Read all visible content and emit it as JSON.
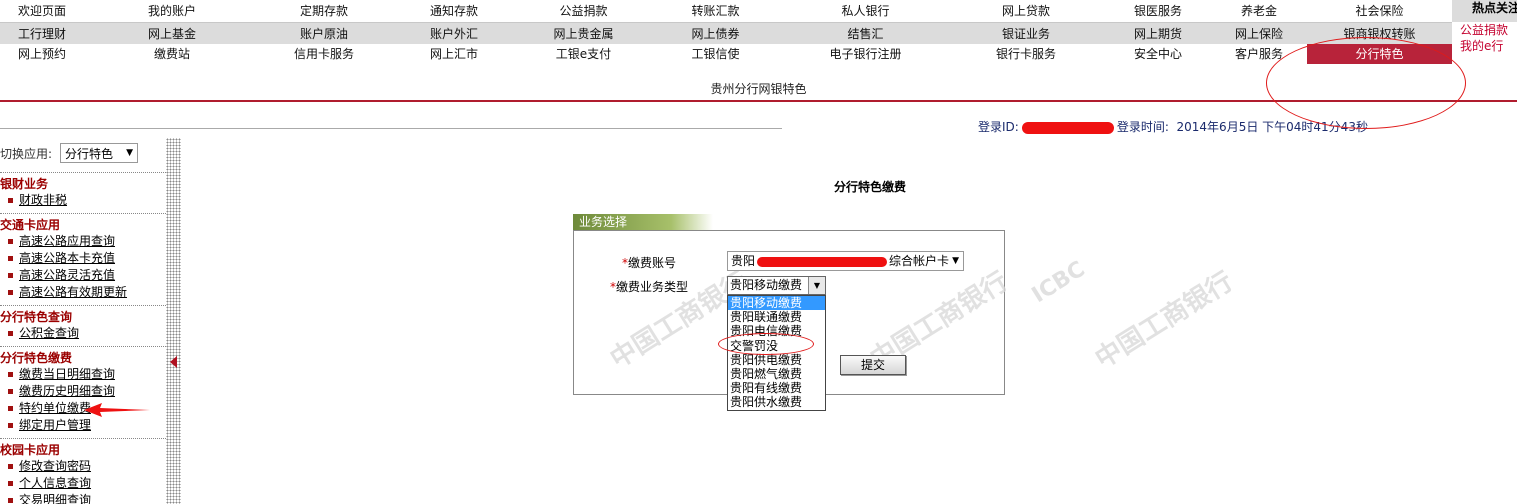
{
  "nav": {
    "row1": [
      "欢迎页面",
      "我的账户",
      "定期存款",
      "通知存款",
      "公益捐款",
      "转账汇款",
      "私人银行",
      "网上贷款",
      "银医服务",
      "养老金",
      "社会保险"
    ],
    "row2": [
      "工行理财",
      "网上基金",
      "账户原油",
      "账户外汇",
      "网上贵金属",
      "网上债券",
      "结售汇",
      "银证业务",
      "网上期货",
      "网上保险",
      "银商银权转账"
    ],
    "row3": [
      "网上预约",
      "缴费站",
      "信用卡服务",
      "网上汇市",
      "工银e支付",
      "工银信使",
      "电子银行注册",
      "银行卡服务",
      "安全中心",
      "客户服务",
      "分行特色"
    ],
    "active": "分行特色"
  },
  "hot": {
    "title": "热点关注",
    "items": [
      "公益捐款",
      "我的e行"
    ]
  },
  "branch_title": "贵州分行网银特色",
  "login": {
    "id_label": "登录ID:",
    "time_label": "登录时间:",
    "time_value": "2014年6月5日 下午04时41分43秒"
  },
  "sidebar": {
    "switch_label": "切换应用:",
    "switch_value": "分行特色",
    "sections": [
      {
        "title": "银财业务",
        "items": [
          "财政非税"
        ]
      },
      {
        "title": "交通卡应用",
        "items": [
          "高速公路应用查询",
          "高速公路本卡充值",
          "高速公路灵活充值",
          "高速公路有效期更新"
        ]
      },
      {
        "title": "分行特色查询",
        "items": [
          "公积金查询"
        ]
      },
      {
        "title": "分行特色缴费",
        "items": [
          "缴费当日明细查询",
          "缴费历史明细查询",
          "特约单位缴费",
          "绑定用户管理"
        ]
      },
      {
        "title": "校园卡应用",
        "items": [
          "修改查询密码",
          "个人信息查询",
          "交易明细查询"
        ]
      }
    ]
  },
  "main": {
    "title": "分行特色缴费",
    "panel_tab": "业务选择",
    "account_label": "缴费账号",
    "account_prefix": "贵阳",
    "account_suffix": "综合帐户卡",
    "type_label": "缴费业务类型",
    "type_value": "贵阳移动缴费",
    "type_options": [
      "贵阳移动缴费",
      "贵阳联通缴费",
      "贵阳电信缴费",
      "交警罚没",
      "贵阳供电缴费",
      "贵阳燃气缴费",
      "贵阳有线缴费",
      "贵阳供水缴费"
    ],
    "submit_label": "提交",
    "watermark_text": "中国工商银行",
    "watermark_logo": "ICBC"
  },
  "colors": {
    "brand_red": "#b01c2e",
    "annotation_red": "#e01a1a",
    "dropdown_selected": "#3399ff"
  }
}
